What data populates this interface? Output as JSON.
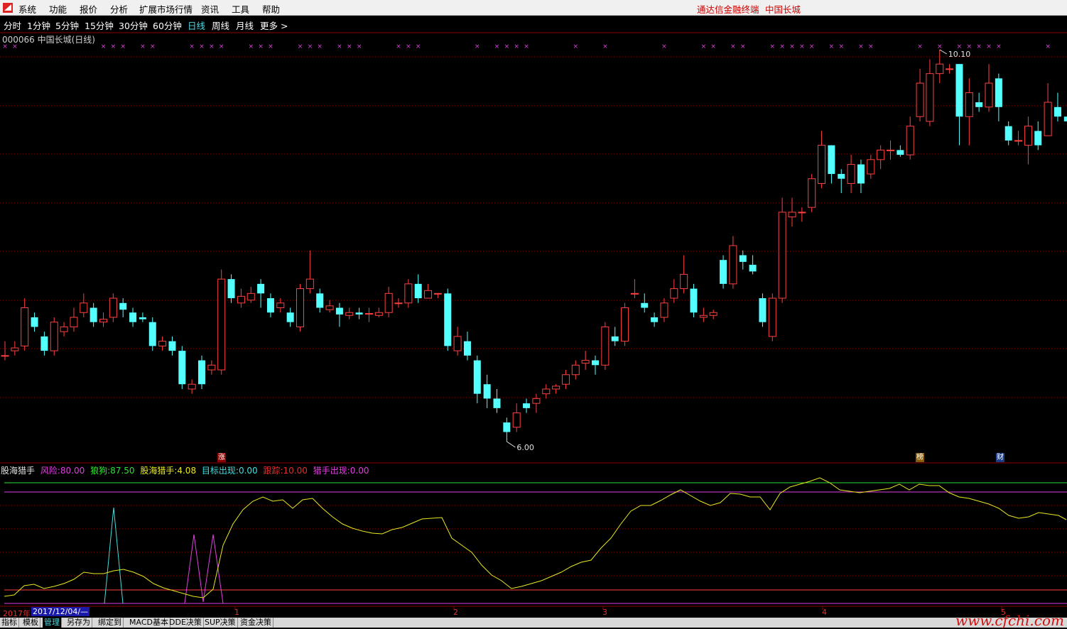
{
  "menu": [
    "系统",
    "功能",
    "报价",
    "分析",
    "扩展市场行情",
    "资讯",
    "工具",
    "帮助"
  ],
  "app_title": "通达信金融终端",
  "stock_title": "中国长城",
  "periods": [
    "分时",
    "1分钟",
    "5分钟",
    "15分钟",
    "30分钟",
    "60分钟",
    "日线",
    "周线",
    "月线",
    "更多 >"
  ],
  "active_period": "日线",
  "chart_title": "000066 中国长城(日线)",
  "price_high_label": "10.10",
  "price_low_label": "6.00",
  "flags": [
    "涨",
    "榜",
    "财"
  ],
  "indicator": {
    "name": "股海猎手",
    "items": [
      {
        "label": "风险:",
        "value": "80.00",
        "color": "#e040e0"
      },
      {
        "label": "狼狗:",
        "value": "87.50",
        "color": "#30e030"
      },
      {
        "label": "股海猎手:",
        "value": "4.08",
        "color": "#e8e820"
      },
      {
        "label": "目标出现:",
        "value": "0.00",
        "color": "#40e0e0"
      },
      {
        "label": "跟踪:",
        "value": "10.00",
        "color": "#e03030"
      },
      {
        "label": "猎手出现:",
        "value": "0.00",
        "color": "#e040e0"
      }
    ]
  },
  "date_readout": {
    "year": "2017年",
    "date": "2017/12/04/—"
  },
  "x_ticks": [
    "1",
    "2",
    "3",
    "4",
    "5"
  ],
  "bottom_tabs": [
    "指标",
    "模板",
    "管理",
    "另存为",
    "绑定到",
    "MACD基本",
    "DDE决策",
    "SUP决策",
    "资金决策"
  ],
  "active_bottom_tab": "管理",
  "watermark": "www.cfchi.com",
  "colors": {
    "up": "#ff4040",
    "down": "#54ffff",
    "grid": "#8b0000",
    "yellow": "#e8e820",
    "green": "#30e030",
    "magenta": "#e040e0",
    "cyan": "#40e0e0"
  },
  "chart_data": {
    "type": "candlestick",
    "price_range": [
      6.0,
      10.1
    ],
    "candles": [
      [
        6.9,
        6.9,
        7.05,
        6.85
      ],
      [
        6.95,
        6.98,
        7.05,
        6.9
      ],
      [
        7.0,
        7.4,
        7.5,
        6.95
      ],
      [
        7.3,
        7.2,
        7.35,
        7.15
      ],
      [
        7.1,
        6.95,
        7.15,
        6.9
      ],
      [
        6.95,
        7.25,
        7.3,
        6.9
      ],
      [
        7.15,
        7.2,
        7.25,
        7.1
      ],
      [
        7.2,
        7.3,
        7.4,
        7.15
      ],
      [
        7.35,
        7.45,
        7.55,
        7.3
      ],
      [
        7.4,
        7.25,
        7.45,
        7.2
      ],
      [
        7.25,
        7.28,
        7.35,
        7.2
      ],
      [
        7.3,
        7.5,
        7.55,
        7.25
      ],
      [
        7.45,
        7.38,
        7.5,
        7.3
      ],
      [
        7.35,
        7.25,
        7.4,
        7.2
      ],
      [
        7.3,
        7.28,
        7.35,
        7.25
      ],
      [
        7.25,
        7.0,
        7.3,
        6.95
      ],
      [
        7.0,
        7.05,
        7.1,
        6.95
      ],
      [
        7.05,
        6.95,
        7.1,
        6.9
      ],
      [
        6.95,
        6.6,
        7.0,
        6.55
      ],
      [
        6.55,
        6.6,
        6.65,
        6.5
      ],
      [
        6.85,
        6.6,
        6.9,
        6.55
      ],
      [
        6.75,
        6.8,
        6.85,
        6.7
      ],
      [
        6.75,
        7.7,
        7.8,
        6.7
      ],
      [
        7.7,
        7.5,
        7.75,
        7.45
      ],
      [
        7.45,
        7.52,
        7.6,
        7.4
      ],
      [
        7.48,
        7.55,
        7.62,
        7.45
      ],
      [
        7.65,
        7.55,
        7.7,
        7.4
      ],
      [
        7.5,
        7.35,
        7.55,
        7.3
      ],
      [
        7.4,
        7.45,
        7.5,
        7.35
      ],
      [
        7.35,
        7.25,
        7.4,
        7.2
      ],
      [
        7.2,
        7.6,
        7.65,
        7.15
      ],
      [
        7.6,
        7.7,
        8.0,
        7.55
      ],
      [
        7.55,
        7.4,
        7.6,
        7.35
      ],
      [
        7.38,
        7.42,
        7.48,
        7.35
      ],
      [
        7.4,
        7.33,
        7.45,
        7.2
      ],
      [
        7.32,
        7.35,
        7.4,
        7.28
      ],
      [
        7.35,
        7.33,
        7.4,
        7.28
      ],
      [
        7.34,
        7.34,
        7.4,
        7.25
      ],
      [
        7.32,
        7.35,
        7.4,
        7.3
      ],
      [
        7.35,
        7.55,
        7.62,
        7.3
      ],
      [
        7.45,
        7.45,
        7.5,
        7.4
      ],
      [
        7.45,
        7.65,
        7.7,
        7.4
      ],
      [
        7.65,
        7.5,
        7.75,
        7.45
      ],
      [
        7.5,
        7.58,
        7.65,
        7.5
      ],
      [
        7.55,
        7.55,
        7.55,
        7.5
      ],
      [
        7.55,
        7.0,
        7.6,
        6.95
      ],
      [
        6.95,
        7.1,
        7.2,
        6.9
      ],
      [
        7.05,
        6.9,
        7.15,
        6.85
      ],
      [
        6.85,
        6.5,
        6.9,
        6.4
      ],
      [
        6.6,
        6.45,
        6.7,
        6.35
      ],
      [
        6.45,
        6.35,
        6.55,
        6.3
      ],
      [
        6.2,
        6.1,
        6.25,
        6.0
      ],
      [
        6.15,
        6.3,
        6.4,
        6.1
      ],
      [
        6.4,
        6.35,
        6.45,
        6.3
      ],
      [
        6.4,
        6.45,
        6.5,
        6.3
      ],
      [
        6.5,
        6.55,
        6.6,
        6.45
      ],
      [
        6.55,
        6.58,
        6.6,
        6.5
      ],
      [
        6.6,
        6.7,
        6.75,
        6.55
      ],
      [
        6.7,
        6.8,
        6.85,
        6.65
      ],
      [
        6.82,
        6.85,
        6.95,
        6.75
      ],
      [
        6.85,
        6.8,
        6.9,
        6.7
      ],
      [
        6.8,
        7.2,
        7.25,
        6.75
      ],
      [
        7.1,
        7.05,
        7.2,
        7.0
      ],
      [
        7.05,
        7.4,
        7.45,
        7.0
      ],
      [
        7.55,
        7.55,
        7.7,
        7.5
      ],
      [
        7.45,
        7.4,
        7.55,
        7.35
      ],
      [
        7.3,
        7.25,
        7.35,
        7.2
      ],
      [
        7.3,
        7.45,
        7.5,
        7.25
      ],
      [
        7.5,
        7.6,
        7.7,
        7.45
      ],
      [
        7.6,
        7.75,
        7.95,
        7.55
      ],
      [
        7.6,
        7.35,
        7.65,
        7.3
      ],
      [
        7.3,
        7.32,
        7.4,
        7.25
      ],
      [
        7.32,
        7.35,
        7.38,
        7.28
      ],
      [
        7.9,
        7.65,
        7.95,
        7.6
      ],
      [
        7.65,
        8.05,
        8.15,
        7.6
      ],
      [
        7.95,
        7.88,
        8.0,
        7.8
      ],
      [
        7.85,
        7.78,
        7.95,
        7.75
      ],
      [
        7.5,
        7.25,
        7.55,
        7.2
      ],
      [
        7.1,
        7.5,
        7.55,
        7.05
      ],
      [
        7.5,
        8.4,
        8.55,
        7.45
      ],
      [
        8.35,
        8.4,
        8.55,
        8.25
      ],
      [
        8.4,
        8.4,
        8.45,
        8.3
      ],
      [
        8.45,
        8.75,
        8.8,
        8.4
      ],
      [
        8.7,
        9.1,
        9.25,
        8.65
      ],
      [
        9.1,
        8.8,
        9.1,
        8.7
      ],
      [
        8.8,
        8.75,
        8.85,
        8.6
      ],
      [
        8.7,
        8.9,
        9.0,
        8.6
      ],
      [
        8.9,
        8.7,
        8.95,
        8.6
      ],
      [
        8.8,
        8.95,
        9.0,
        8.75
      ],
      [
        8.95,
        9.05,
        9.1,
        8.85
      ],
      [
        9.05,
        9.05,
        9.15,
        8.95
      ],
      [
        9.05,
        9.0,
        9.1,
        8.98
      ],
      [
        9.0,
        9.3,
        9.4,
        8.95
      ],
      [
        9.4,
        9.75,
        9.9,
        9.35
      ],
      [
        9.35,
        9.85,
        10.0,
        9.3
      ],
      [
        9.85,
        9.95,
        10.1,
        9.75
      ],
      [
        9.9,
        9.9,
        9.95,
        9.85
      ],
      [
        9.95,
        9.4,
        9.95,
        9.1
      ],
      [
        9.4,
        9.65,
        9.8,
        9.1
      ],
      [
        9.55,
        9.5,
        9.65,
        9.45
      ],
      [
        9.5,
        9.75,
        9.95,
        9.45
      ],
      [
        9.8,
        9.5,
        9.85,
        9.35
      ],
      [
        9.3,
        9.15,
        9.35,
        9.1
      ],
      [
        9.15,
        9.15,
        9.25,
        9.1
      ],
      [
        9.1,
        9.3,
        9.4,
        8.9
      ],
      [
        9.25,
        9.1,
        9.35,
        9.05
      ],
      [
        9.2,
        9.55,
        9.75,
        9.2
      ],
      [
        9.5,
        9.4,
        9.65,
        9.35
      ],
      [
        9.4,
        9.35,
        9.45,
        9.3
      ]
    ]
  }
}
